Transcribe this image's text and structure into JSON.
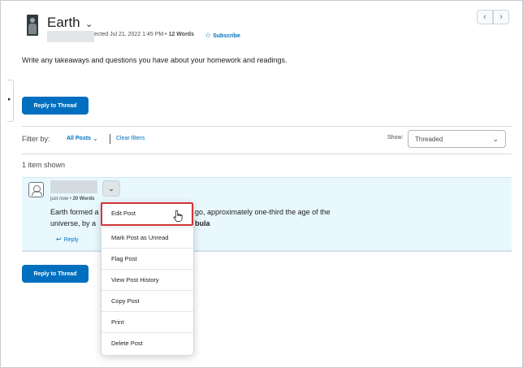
{
  "header": {
    "title": "Earth",
    "meta_prefix": "ected Jul 21, 2022 1:45 PM",
    "meta_separator": " • ",
    "meta_words": "12 Words",
    "subscribe_label": "Subscribe",
    "prev_label": "‹",
    "next_label": "›"
  },
  "prompt": "Write any takeaways and questions you have about your homework and readings.",
  "actions": {
    "reply_thread_label": "Reply to Thread"
  },
  "filter": {
    "label": "Filter by:",
    "selected": "All Posts",
    "clear_label": "Clear filters",
    "show_label": "Show:",
    "show_value": "Threaded"
  },
  "results": {
    "count_text": "1 item shown"
  },
  "post": {
    "time": "just now",
    "separator": " • ",
    "words": "20 Words",
    "body_line1_start": "Earth formed a",
    "body_line1_end": "go, approximately one-third the age of the",
    "body_line2_start": "universe, by a",
    "body_line2_end": "bula",
    "reply_label": "Reply"
  },
  "menu": {
    "items": [
      "Edit Post",
      "Mark Post as Unread",
      "Flag Post",
      "View Post History",
      "Copy Post",
      "Print",
      "Delete Post"
    ]
  },
  "colors": {
    "accent": "#006fbf",
    "highlight_border": "#d23437",
    "post_background": "#e9f8fd"
  }
}
